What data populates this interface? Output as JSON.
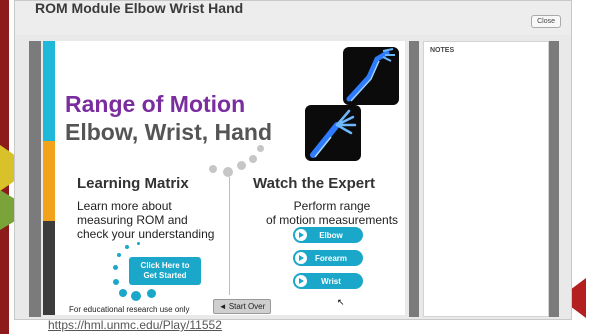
{
  "window": {
    "title": "ROM Module Elbow Wrist Hand",
    "close_label": "Close"
  },
  "slide": {
    "title_line1": "Range of Motion",
    "title_line2": "Elbow, Wrist, Hand",
    "learning_matrix": {
      "heading": "Learning Matrix",
      "text": "Learn more about\nmeasuring ROM and\ncheck your understanding",
      "button_label": "Click Here to\nGet Started"
    },
    "watch_expert": {
      "heading": "Watch the Expert",
      "text": "Perform range\nof motion measurements",
      "buttons": [
        "Elbow",
        "Forearm",
        "Wrist"
      ]
    },
    "footnote": "For educational research use only",
    "start_over_label": "◄ Start Over"
  },
  "notes": {
    "label": "NOTES"
  },
  "source_url": "https://hml.unmc.edu/Play/11552",
  "colors": {
    "title_purple": "#7a2d9e",
    "accent_blue": "#1aa7c9",
    "stripe_orange": "#f3a21b",
    "edge_red": "#8e1b1b"
  }
}
